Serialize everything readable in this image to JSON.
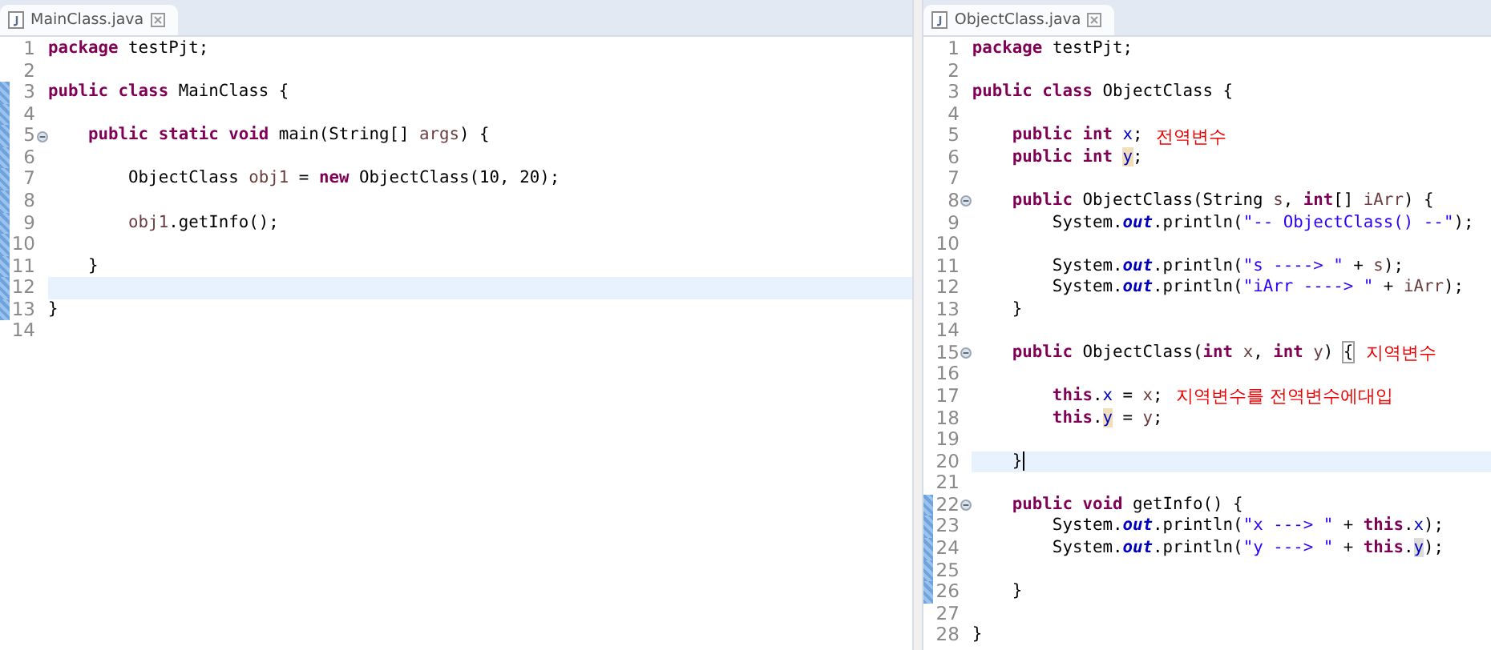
{
  "editors": [
    {
      "tab": {
        "label": "MainClass.java"
      },
      "lines": [
        {
          "number": "1",
          "changed": false,
          "fold": false,
          "current": false,
          "caret": false,
          "tokens": [
            {
              "kind": "keyword",
              "text": "package"
            },
            {
              "kind": "plain",
              "text": " testPjt;"
            }
          ]
        },
        {
          "number": "2",
          "changed": false,
          "fold": false,
          "current": false,
          "caret": false
        },
        {
          "number": "3",
          "changed": true,
          "fold": false,
          "current": false,
          "caret": false,
          "tokens": [
            {
              "kind": "keyword",
              "text": "public class"
            },
            {
              "kind": "plain",
              "text": " MainClass {"
            }
          ]
        },
        {
          "number": "4",
          "changed": true,
          "fold": false,
          "current": false,
          "caret": false
        },
        {
          "number": "5",
          "changed": true,
          "fold": true,
          "current": false,
          "caret": false,
          "tokens": [
            {
              "kind": "keyword",
              "text": "    public static void"
            },
            {
              "kind": "plain",
              "text": " main(String[] "
            },
            {
              "kind": "local",
              "text": "args"
            },
            {
              "kind": "plain",
              "text": ") {"
            }
          ]
        },
        {
          "number": "6",
          "changed": true,
          "fold": false,
          "current": false,
          "caret": false
        },
        {
          "number": "7",
          "changed": true,
          "fold": false,
          "current": false,
          "caret": false,
          "tokens": [
            {
              "kind": "plain",
              "text": "        ObjectClass "
            },
            {
              "kind": "local",
              "text": "obj1"
            },
            {
              "kind": "plain",
              "text": " = "
            },
            {
              "kind": "keyword",
              "text": "new"
            },
            {
              "kind": "plain",
              "text": " ObjectClass(10, 20);"
            }
          ]
        },
        {
          "number": "8",
          "changed": true,
          "fold": false,
          "current": false,
          "caret": false
        },
        {
          "number": "9",
          "changed": true,
          "fold": false,
          "current": false,
          "caret": false,
          "tokens": [
            {
              "kind": "local",
              "text": "        obj1"
            },
            {
              "kind": "plain",
              "text": ".getInfo();"
            }
          ]
        },
        {
          "number": "10",
          "changed": true,
          "fold": false,
          "current": false,
          "caret": false
        },
        {
          "number": "11",
          "changed": true,
          "fold": false,
          "current": false,
          "caret": false,
          "tokens": [
            {
              "kind": "plain",
              "text": "    }"
            }
          ]
        },
        {
          "number": "12",
          "changed": true,
          "fold": false,
          "current": true,
          "caret": false
        },
        {
          "number": "13",
          "changed": true,
          "fold": false,
          "current": false,
          "caret": false,
          "tokens": [
            {
              "kind": "plain",
              "text": "}"
            }
          ]
        },
        {
          "number": "14",
          "changed": false,
          "fold": false,
          "current": false,
          "caret": false
        }
      ]
    },
    {
      "tab": {
        "label": "ObjectClass.java"
      },
      "lines": [
        {
          "number": "1",
          "changed": false,
          "fold": false,
          "current": false,
          "caret": false,
          "tokens": [
            {
              "kind": "keyword",
              "text": "package"
            },
            {
              "kind": "plain",
              "text": " testPjt;"
            }
          ]
        },
        {
          "number": "2",
          "changed": false,
          "fold": false,
          "current": false,
          "caret": false
        },
        {
          "number": "3",
          "changed": false,
          "fold": false,
          "current": false,
          "caret": false,
          "tokens": [
            {
              "kind": "keyword",
              "text": "public class"
            },
            {
              "kind": "plain",
              "text": " ObjectClass {"
            }
          ]
        },
        {
          "number": "4",
          "changed": false,
          "fold": false,
          "current": false,
          "caret": false
        },
        {
          "number": "5",
          "changed": false,
          "fold": false,
          "current": false,
          "caret": false,
          "tokens": [
            {
              "kind": "keyword",
              "text": "    public int "
            },
            {
              "kind": "field",
              "text": "x"
            },
            {
              "kind": "plain",
              "text": ";"
            }
          ],
          "annotation": "전역변수"
        },
        {
          "number": "6",
          "changed": false,
          "fold": false,
          "current": false,
          "caret": false,
          "tokens": [
            {
              "kind": "keyword",
              "text": "    public int "
            },
            {
              "kind": "occurrence",
              "text": "y"
            },
            {
              "kind": "plain",
              "text": ";"
            }
          ]
        },
        {
          "number": "7",
          "changed": false,
          "fold": false,
          "current": false,
          "caret": false
        },
        {
          "number": "8",
          "changed": false,
          "fold": true,
          "current": false,
          "caret": false,
          "tokens": [
            {
              "kind": "keyword",
              "text": "    public"
            },
            {
              "kind": "plain",
              "text": " ObjectClass(String "
            },
            {
              "kind": "local",
              "text": "s"
            },
            {
              "kind": "plain",
              "text": ", "
            },
            {
              "kind": "keyword",
              "text": "int"
            },
            {
              "kind": "plain",
              "text": "[] "
            },
            {
              "kind": "local",
              "text": "iArr"
            },
            {
              "kind": "plain",
              "text": ") {"
            }
          ]
        },
        {
          "number": "9",
          "changed": false,
          "fold": false,
          "current": false,
          "caret": false,
          "tokens": [
            {
              "kind": "plain",
              "text": "        System."
            },
            {
              "kind": "static",
              "text": "out"
            },
            {
              "kind": "plain",
              "text": ".println("
            },
            {
              "kind": "string",
              "text": "\"-- ObjectClass() --\""
            },
            {
              "kind": "plain",
              "text": ");"
            }
          ]
        },
        {
          "number": "10",
          "changed": false,
          "fold": false,
          "current": false,
          "caret": false
        },
        {
          "number": "11",
          "changed": false,
          "fold": false,
          "current": false,
          "caret": false,
          "tokens": [
            {
              "kind": "plain",
              "text": "        System."
            },
            {
              "kind": "static",
              "text": "out"
            },
            {
              "kind": "plain",
              "text": ".println("
            },
            {
              "kind": "string",
              "text": "\"s ----> \""
            },
            {
              "kind": "plain",
              "text": " + "
            },
            {
              "kind": "local",
              "text": "s"
            },
            {
              "kind": "plain",
              "text": ");"
            }
          ]
        },
        {
          "number": "12",
          "changed": false,
          "fold": false,
          "current": false,
          "caret": false,
          "tokens": [
            {
              "kind": "plain",
              "text": "        System."
            },
            {
              "kind": "static",
              "text": "out"
            },
            {
              "kind": "plain",
              "text": ".println("
            },
            {
              "kind": "string",
              "text": "\"iArr ----> \""
            },
            {
              "kind": "plain",
              "text": " + "
            },
            {
              "kind": "local",
              "text": "iArr"
            },
            {
              "kind": "plain",
              "text": ");"
            }
          ]
        },
        {
          "number": "13",
          "changed": false,
          "fold": false,
          "current": false,
          "caret": false,
          "tokens": [
            {
              "kind": "plain",
              "text": "    }"
            }
          ]
        },
        {
          "number": "14",
          "changed": false,
          "fold": false,
          "current": false,
          "caret": false
        },
        {
          "number": "15",
          "changed": false,
          "fold": true,
          "current": false,
          "caret": false,
          "tokens": [
            {
              "kind": "keyword",
              "text": "    public"
            },
            {
              "kind": "plain",
              "text": " ObjectClass("
            },
            {
              "kind": "keyword",
              "text": "int "
            },
            {
              "kind": "local",
              "text": "x"
            },
            {
              "kind": "plain",
              "text": ", "
            },
            {
              "kind": "keyword",
              "text": "int "
            },
            {
              "kind": "local",
              "text": "y"
            },
            {
              "kind": "plain",
              "text": ") "
            },
            {
              "kind": "bracket-match",
              "text": "{"
            }
          ],
          "annotation": "지역변수"
        },
        {
          "number": "16",
          "changed": false,
          "fold": false,
          "current": false,
          "caret": false
        },
        {
          "number": "17",
          "changed": false,
          "fold": false,
          "current": false,
          "caret": false,
          "tokens": [
            {
              "kind": "keyword",
              "text": "        this"
            },
            {
              "kind": "plain",
              "text": "."
            },
            {
              "kind": "field",
              "text": "x"
            },
            {
              "kind": "plain",
              "text": " = "
            },
            {
              "kind": "local",
              "text": "x"
            },
            {
              "kind": "plain",
              "text": ";"
            }
          ],
          "annotation": "지역변수를 전역변수에대입"
        },
        {
          "number": "18",
          "changed": false,
          "fold": false,
          "current": false,
          "caret": false,
          "tokens": [
            {
              "kind": "keyword",
              "text": "        this"
            },
            {
              "kind": "plain",
              "text": "."
            },
            {
              "kind": "occurrence",
              "text": "y"
            },
            {
              "kind": "plain",
              "text": " = "
            },
            {
              "kind": "local",
              "text": "y"
            },
            {
              "kind": "plain",
              "text": ";"
            }
          ]
        },
        {
          "number": "19",
          "changed": false,
          "fold": false,
          "current": false,
          "caret": false
        },
        {
          "number": "20",
          "changed": false,
          "fold": false,
          "current": true,
          "caret": true,
          "tokens": [
            {
              "kind": "plain",
              "text": "    }"
            }
          ]
        },
        {
          "number": "21",
          "changed": false,
          "fold": false,
          "current": false,
          "caret": false
        },
        {
          "number": "22",
          "changed": true,
          "fold": true,
          "current": false,
          "caret": false,
          "tokens": [
            {
              "kind": "keyword",
              "text": "    public void"
            },
            {
              "kind": "plain",
              "text": " getInfo() {"
            }
          ]
        },
        {
          "number": "23",
          "changed": true,
          "fold": false,
          "current": false,
          "caret": false,
          "tokens": [
            {
              "kind": "plain",
              "text": "        System."
            },
            {
              "kind": "static",
              "text": "out"
            },
            {
              "kind": "plain",
              "text": ".println("
            },
            {
              "kind": "string",
              "text": "\"x ---> \""
            },
            {
              "kind": "plain",
              "text": " + "
            },
            {
              "kind": "keyword",
              "text": "this"
            },
            {
              "kind": "plain",
              "text": "."
            },
            {
              "kind": "field",
              "text": "x"
            },
            {
              "kind": "plain",
              "text": ");"
            }
          ]
        },
        {
          "number": "24",
          "changed": true,
          "fold": false,
          "current": false,
          "caret": false,
          "tokens": [
            {
              "kind": "plain",
              "text": "        System."
            },
            {
              "kind": "static",
              "text": "out"
            },
            {
              "kind": "plain",
              "text": ".println("
            },
            {
              "kind": "string",
              "text": "\"y ---> \""
            },
            {
              "kind": "plain",
              "text": " + "
            },
            {
              "kind": "keyword",
              "text": "this"
            },
            {
              "kind": "plain",
              "text": "."
            },
            {
              "kind": "read-occurrence",
              "text": "y"
            },
            {
              "kind": "plain",
              "text": ");"
            }
          ]
        },
        {
          "number": "25",
          "changed": true,
          "fold": false,
          "current": false,
          "caret": false
        },
        {
          "number": "26",
          "changed": true,
          "fold": false,
          "current": false,
          "caret": false,
          "tokens": [
            {
              "kind": "plain",
              "text": "    }"
            }
          ]
        },
        {
          "number": "27",
          "changed": false,
          "fold": false,
          "current": false,
          "caret": false
        },
        {
          "number": "28",
          "changed": false,
          "fold": false,
          "current": false,
          "caret": false,
          "tokens": [
            {
              "kind": "plain",
              "text": "}"
            }
          ]
        }
      ]
    }
  ]
}
